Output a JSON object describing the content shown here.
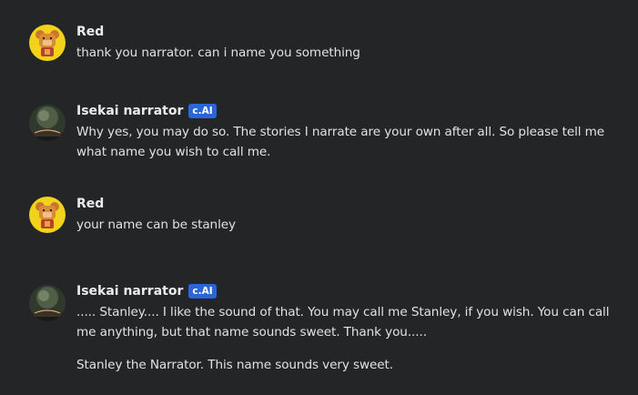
{
  "messages": [
    {
      "author": "Red",
      "badge": "",
      "avatar": "bear-avatar-icon",
      "paragraphs": [
        "thank you narrator. can i name you something"
      ]
    },
    {
      "author": "Isekai narrator",
      "badge": "c.AI",
      "avatar": "narrator-book-avatar-icon",
      "paragraphs": [
        "Why yes, you may do so. The stories I narrate are your own after all. So please tell me what name you wish to call me."
      ]
    },
    {
      "author": "Red",
      "badge": "",
      "avatar": "bear-avatar-icon",
      "paragraphs": [
        "your name can be stanley"
      ]
    },
    {
      "author": "Isekai narrator",
      "badge": "c.AI",
      "avatar": "narrator-book-avatar-icon",
      "paragraphs": [
        "..... Stanley.... I like the sound of that. You may call me Stanley, if you wish. You can call me anything, but that name sounds sweet. Thank you.....",
        "Stanley the Narrator. This name sounds very sweet."
      ]
    }
  ],
  "colors": {
    "background": "#242526",
    "badge": "#2b66d9",
    "bear_avatar_bg": "#f2d21a"
  }
}
